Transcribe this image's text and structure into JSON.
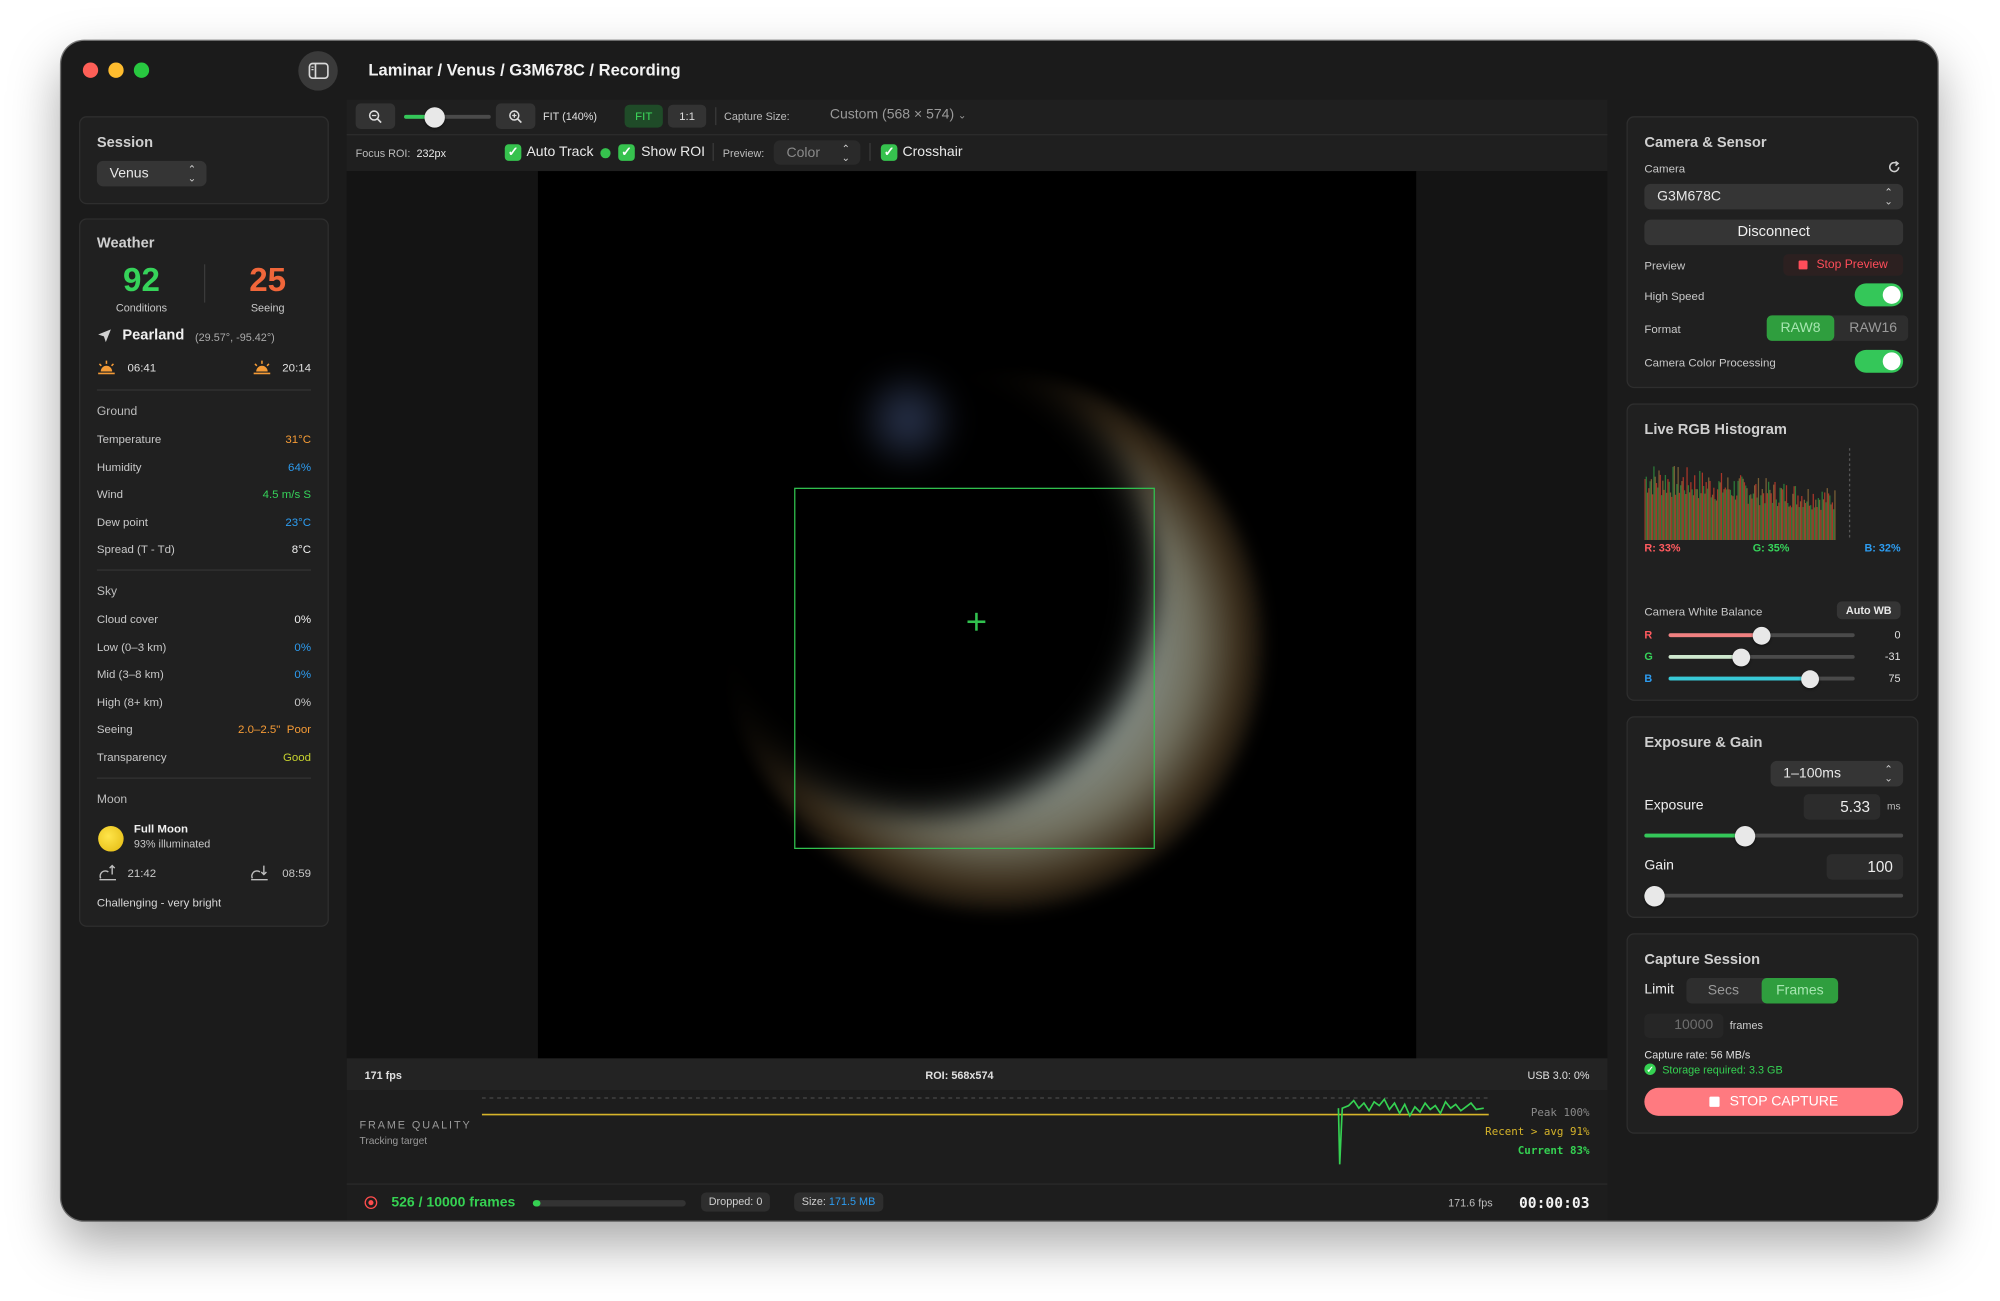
{
  "window": {
    "title": "Laminar / Venus / G3M678C / Recording",
    "sidebar_toggle_icon": "sidebar-icon"
  },
  "session": {
    "heading": "Session",
    "target": "Venus"
  },
  "weather": {
    "heading": "Weather",
    "conditions_value": "92",
    "conditions_label": "Conditions",
    "seeing_value": "25",
    "seeing_label": "Seeing",
    "location": "Pearland",
    "coords": "(29.57°, -95.42°)",
    "sunrise": "06:41",
    "sunset": "20:14",
    "ground": {
      "heading": "Ground",
      "rows": [
        {
          "label": "Temperature",
          "value": "31°C",
          "color": "#f59b36"
        },
        {
          "label": "Humidity",
          "value": "64%",
          "color": "#2d9cf0"
        },
        {
          "label": "Wind",
          "value": "4.5 m/s S",
          "color": "#36d35a"
        },
        {
          "label": "Dew point",
          "value": "23°C",
          "color": "#2d9cf0"
        },
        {
          "label": "Spread (T - Td)",
          "value": "8°C",
          "color": "#f0f0f0"
        }
      ]
    },
    "sky": {
      "heading": "Sky",
      "rows": [
        {
          "label": "Cloud cover",
          "value": "0%",
          "color": "#f0f0f0"
        },
        {
          "label": "Low (0–3 km)",
          "value": "0%",
          "color": "#2d9cf0"
        },
        {
          "label": "Mid (3–8 km)",
          "value": "0%",
          "color": "#2d9cf0"
        },
        {
          "label": "High (8+ km)",
          "value": "0%",
          "color": "#c8c8c8"
        }
      ],
      "seeing_label": "Seeing",
      "seeing_range": "2.0–2.5\"",
      "seeing_quality": "Poor",
      "transparency_label": "Transparency",
      "transparency_value": "Good"
    },
    "moon": {
      "heading": "Moon",
      "phase": "Full Moon",
      "illumination": "93% illuminated",
      "moonrise": "21:42",
      "moonset": "08:59",
      "note": "Challenging - very bright"
    }
  },
  "toolbar": {
    "zoom_label": "FIT (140%)",
    "zoom_slider_fraction": 0.35,
    "fit_button": "FIT",
    "one_to_one_button": "1:1",
    "capture_size_label": "Capture Size:",
    "capture_size_value": "Custom (568 × 574)",
    "focus_roi_label": "Focus ROI:",
    "focus_roi_value": "232px",
    "auto_track_label": "Auto Track",
    "show_roi_label": "Show ROI",
    "preview_label": "Preview:",
    "preview_value": "Color",
    "crosshair_label": "Crosshair"
  },
  "status": {
    "fps": "171 fps",
    "roi": "ROI: 568x574",
    "usb": "USB 3.0: 0%"
  },
  "frame_quality": {
    "title": "FRAME QUALITY",
    "subtitle": "Tracking target",
    "peak": "Peak 100%",
    "recent": "Recent > avg 91%",
    "current": "Current 83%"
  },
  "recording": {
    "frames": "526 / 10000 frames",
    "progress_fraction": 0.0526,
    "dropped": "Dropped: 0",
    "size_label": "Size:",
    "size_value": "171.5 MB",
    "rate": "171.6 fps",
    "elapsed": "00:00:03"
  },
  "camera": {
    "heading": "Camera & Sensor",
    "camera_label": "Camera",
    "camera_value": "G3M678C",
    "disconnect_button": "Disconnect",
    "preview_label": "Preview",
    "stop_preview_button": "Stop Preview",
    "high_speed_label": "High Speed",
    "high_speed_on": true,
    "format_label": "Format",
    "format_options": [
      "RAW8",
      "RAW16"
    ],
    "format_selected": "RAW8",
    "color_processing_label": "Camera Color Processing",
    "color_processing_on": true
  },
  "histogram": {
    "heading": "Live RGB Histogram",
    "r_label": "R: 33%",
    "g_label": "G: 35%",
    "b_label": "B: 32%",
    "wb_label": "Camera White Balance",
    "auto_wb_button": "Auto WB",
    "wb": [
      {
        "channel": "R",
        "value": "0",
        "fraction": 0.5,
        "color": "#f08080"
      },
      {
        "channel": "G",
        "value": "-31",
        "fraction": 0.39,
        "color": "#cfe9cf"
      },
      {
        "channel": "B",
        "value": "75",
        "fraction": 0.76,
        "color": "#38c9d6"
      }
    ]
  },
  "exposure": {
    "heading": "Exposure & Gain",
    "range_value": "1–100ms",
    "exposure_label": "Exposure",
    "exposure_value": "5.33",
    "exposure_unit": "ms",
    "exposure_fraction": 0.39,
    "gain_label": "Gain",
    "gain_value": "100",
    "gain_fraction": 0.04
  },
  "capture": {
    "heading": "Capture Session",
    "limit_label": "Limit",
    "limit_options": [
      "Secs",
      "Frames"
    ],
    "limit_selected": "Frames",
    "frames_value": "10000",
    "frames_unit": "frames",
    "rate_text": "Capture rate: 56 MB/s",
    "storage_text": "Storage required: 3.3 GB",
    "stop_button": "STOP CAPTURE"
  }
}
